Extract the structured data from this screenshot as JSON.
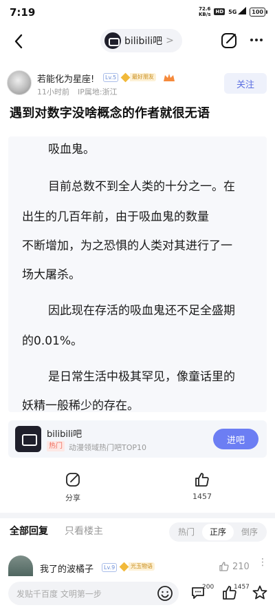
{
  "status_bar": {
    "time": "7:19",
    "net_speed_value": "72.6",
    "net_speed_unit": "KB/s",
    "hd": "HD",
    "signal": "5G",
    "battery": "100"
  },
  "nav": {
    "forum_name": "bilibili吧",
    "forum_chevron": ">"
  },
  "author": {
    "name": "若能化为星座!",
    "level": "Lv.5",
    "badge": "最好朋友",
    "time": "11小时前",
    "ip": "IP属地:浙江",
    "follow_label": "关注"
  },
  "post": {
    "title": "遇到对数字没啥概念的作者就很无语",
    "content_lines": [
      "吸血鬼。",
      "目前总数不到全人类的十分之一。在",
      "出生的几百年前，由于吸血鬼的数量",
      "不断增加，为之恐惧的人类对其进行了一",
      "场大屠杀。",
      "因此现在存活的吸血鬼还不足全盛期",
      "的0.01%。",
      "是日常生活中极其罕见，像童话里的",
      "妖精一般稀少的存在。"
    ]
  },
  "forum_card": {
    "name": "bilibili吧",
    "hot_tag": "热门",
    "rank": "动漫领域热门吧TOP10",
    "enter_label": "进吧"
  },
  "actions": {
    "share_label": "分享",
    "like_count": "1457"
  },
  "replies": {
    "tab_all": "全部回复",
    "tab_owner": "只看楼主",
    "sort_options": [
      "热门",
      "正序",
      "倒序"
    ],
    "active_sort": "正序",
    "first_reply": {
      "user": "我了的波橘子",
      "level": "Lv.9",
      "badge": "光玉物语",
      "likes": "210",
      "more": "⋮"
    }
  },
  "bottom_bar": {
    "placeholder": "发贴千百度 文明第一步",
    "comment_count": "200",
    "like_count": "1457"
  },
  "colors": {
    "accent": "#6c7ef3",
    "follow_text": "#5b6ee1",
    "hot_tag": "#f06a5a",
    "gold_badge": "#f1b93a"
  }
}
